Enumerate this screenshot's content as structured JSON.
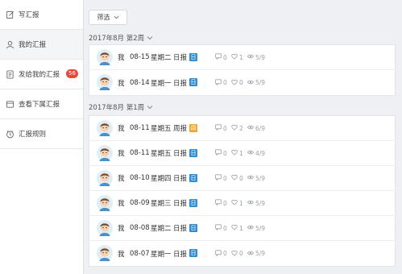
{
  "sidebar": {
    "items": [
      {
        "label": "写汇报",
        "icon": "edit-icon"
      },
      {
        "label": "我的汇报",
        "icon": "user-icon"
      },
      {
        "label": "发给我的汇报",
        "icon": "document-icon",
        "badge": "56"
      },
      {
        "label": "查看下属汇报",
        "icon": "folder-icon"
      },
      {
        "label": "汇报规则",
        "icon": "clock-icon"
      }
    ]
  },
  "filter": {
    "label": "筛选",
    "icon": "chevron-down-icon"
  },
  "groups": [
    {
      "title": "2017年8月 第2周",
      "rows": [
        {
          "who": "我",
          "date": "08-15",
          "weekday": "星期二",
          "kind": "日报",
          "tag": "日",
          "tag_color": "#2e8fd6",
          "comments": "0",
          "likes": "1",
          "views": "5/9"
        },
        {
          "who": "我",
          "date": "08-14",
          "weekday": "星期一",
          "kind": "日报",
          "tag": "日",
          "tag_color": "#2e8fd6",
          "comments": "0",
          "likes": "0",
          "views": "5/9"
        }
      ]
    },
    {
      "title": "2017年8月 第1周",
      "rows": [
        {
          "who": "我",
          "date": "08-11",
          "weekday": "星期五",
          "kind": "周报",
          "tag": "周",
          "tag_color": "#f0a530",
          "comments": "0",
          "likes": "2",
          "views": "6/9"
        },
        {
          "who": "我",
          "date": "08-11",
          "weekday": "星期五",
          "kind": "日报",
          "tag": "日",
          "tag_color": "#2e8fd6",
          "comments": "0",
          "likes": "1",
          "views": "4/9"
        },
        {
          "who": "我",
          "date": "08-10",
          "weekday": "星期四",
          "kind": "日报",
          "tag": "日",
          "tag_color": "#2e8fd6",
          "comments": "0",
          "likes": "0",
          "views": "5/9"
        },
        {
          "who": "我",
          "date": "08-09",
          "weekday": "星期三",
          "kind": "日报",
          "tag": "日",
          "tag_color": "#2e8fd6",
          "comments": "0",
          "likes": "1",
          "views": "5/9"
        },
        {
          "who": "我",
          "date": "08-08",
          "weekday": "星期二",
          "kind": "日报",
          "tag": "日",
          "tag_color": "#2e8fd6",
          "comments": "0",
          "likes": "1",
          "views": "5/9"
        },
        {
          "who": "我",
          "date": "08-07",
          "weekday": "星期一",
          "kind": "日报",
          "tag": "日",
          "tag_color": "#2e8fd6",
          "comments": "0",
          "likes": "0",
          "views": "5/9"
        }
      ]
    }
  ]
}
